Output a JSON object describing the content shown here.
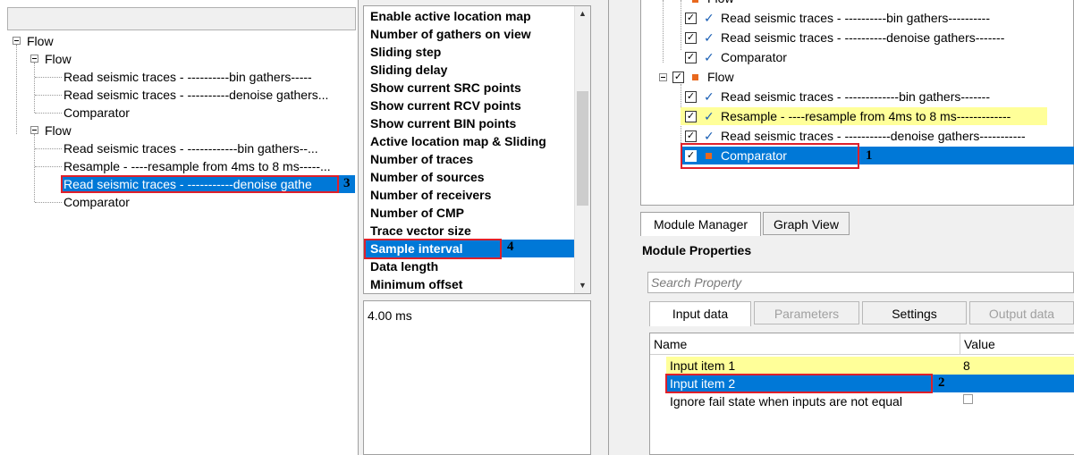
{
  "left_tree": {
    "root": "Flow",
    "flow1": {
      "label": "Flow",
      "items": [
        "Read seismic traces - ----------bin gathers-----",
        "Read seismic traces - ----------denoise gathers...",
        "Comparator"
      ]
    },
    "flow2": {
      "label": "Flow",
      "items": [
        "Read seismic traces - ------------bin gathers--...",
        "Resample - ----resample from 4ms to 8 ms-----...",
        "Read seismic traces - -----------denoise gathe",
        "Comparator"
      ],
      "selected_index": 2
    },
    "callout": "3"
  },
  "property_list": {
    "items": [
      "Enable active location map",
      "Number of gathers on view",
      "Sliding step",
      "Sliding delay",
      "Show current SRC points",
      "Show current RCV points",
      "Show current BIN points",
      "Active location map & Sliding",
      "Number of traces",
      "Number of sources",
      "Number of receivers",
      "Number of CMP",
      "Trace vector size",
      "Sample interval",
      "Data length",
      "Minimum offset"
    ],
    "selected_index": 13,
    "callout": "4",
    "scroll_up_icon": "triangle-up",
    "scroll_down_icon": "triangle-down"
  },
  "value_panel": {
    "text": "4.00 ms"
  },
  "right_tree": {
    "flow1": {
      "label": "Flow",
      "items": [
        "Read seismic traces - ----------bin gathers----------",
        "Read seismic traces - ----------denoise gathers-------",
        "Comparator"
      ]
    },
    "flow2": {
      "label": "Flow",
      "items": [
        "Read seismic traces - -------------bin gathers-------",
        "Resample - ----resample from 4ms to 8 ms-------------",
        "Read seismic traces - -----------denoise gathers-----------",
        "Comparator"
      ],
      "highlighted_index": 1,
      "selected_index": 3
    },
    "callout": "1",
    "highlight_color": "#ffff99",
    "selection_color": "#0078d7",
    "module_marker_color": "#e8681e"
  },
  "tabs": {
    "module_manager": "Module Manager",
    "graph_view": "Graph View"
  },
  "module_properties": {
    "title": "Module Properties",
    "search_placeholder": "Search Property",
    "tabs": [
      "Input data",
      "Parameters",
      "Settings",
      "Output data"
    ],
    "columns": {
      "name": "Name",
      "value": "Value"
    },
    "rows": [
      {
        "name": "Input item 1",
        "value": "8"
      },
      {
        "name": "Input item 2",
        "value": ""
      },
      {
        "name": "Ignore fail state when inputs are not equal",
        "value": ""
      }
    ],
    "callout": "2"
  }
}
